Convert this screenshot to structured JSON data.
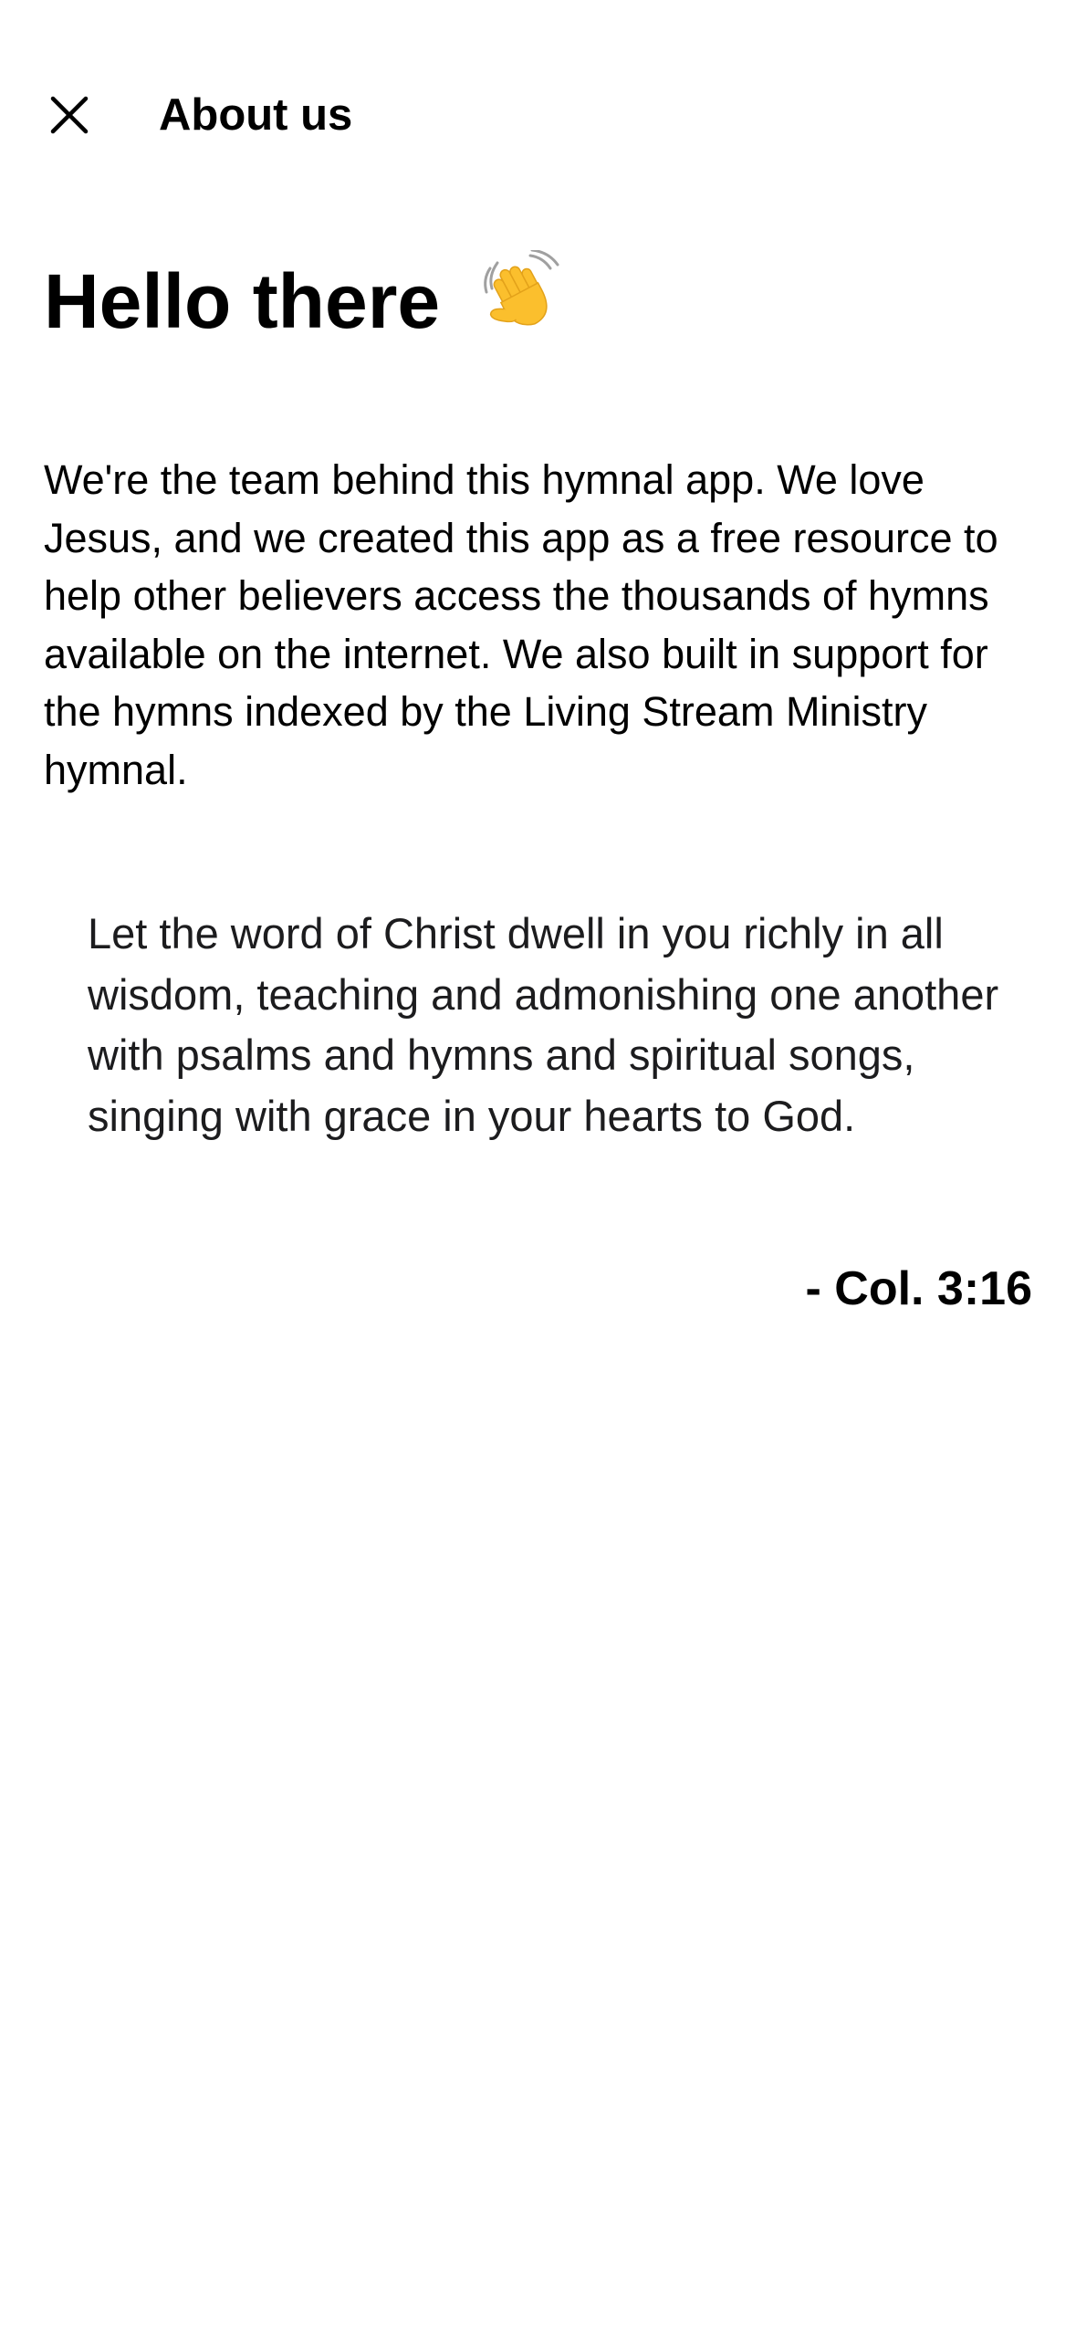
{
  "header": {
    "close_icon": "close-icon",
    "title": "About us"
  },
  "greeting": {
    "text": "Hello there",
    "icon": "waving-hand-icon"
  },
  "intro": {
    "text": "We're the team behind this hymnal app. We love Jesus, and we created this app as a free resource to help other believers access the thousands of hymns available on the internet. We also built in support for the hymns indexed by the Living Stream Ministry hymnal."
  },
  "quote": {
    "text": "Let the word of Christ dwell in you richly in all wisdom, teaching and admonishing one another with psalms and hymns and spiritual songs, singing with grace in your hearts to God.",
    "citation": "- Col. 3:16"
  },
  "colors": {
    "background": "#ffffff",
    "text": "#000000",
    "wave_fill": "#fbbf2d"
  }
}
